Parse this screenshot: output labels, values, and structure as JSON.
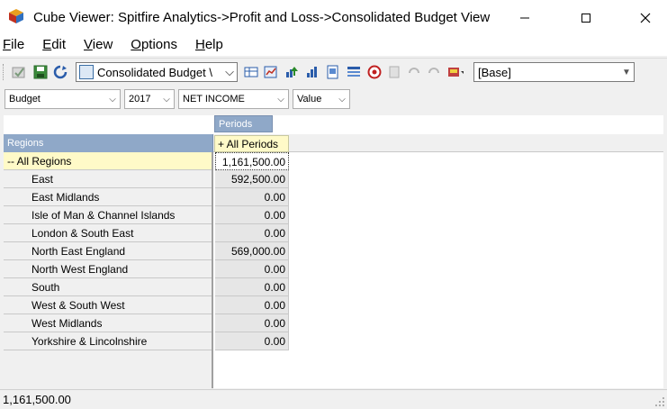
{
  "window": {
    "title": "Cube Viewer: Spitfire Analytics->Profit and Loss->Consolidated Budget View"
  },
  "menu": {
    "file": {
      "rest": "ile",
      "key": "F"
    },
    "edit": {
      "rest": "dit",
      "key": "E"
    },
    "view": {
      "rest": "iew",
      "key": "V"
    },
    "options": {
      "rest": "ptions",
      "key": "O"
    },
    "help": {
      "rest": "elp",
      "key": "H"
    }
  },
  "toolbar": {
    "view_select": "Consolidated Budget \\",
    "base_select": "[Base]"
  },
  "filters": {
    "scenario": "Budget",
    "year": "2017",
    "account": "NET INCOME",
    "measure": "Value"
  },
  "grid": {
    "column_dimension": "Periods",
    "row_dimension": "Regions",
    "column_header": "+ All Periods",
    "rows": [
      {
        "label": "-- All Regions",
        "value": "1,161,500.00"
      },
      {
        "label": "East",
        "value": "592,500.00"
      },
      {
        "label": "East Midlands",
        "value": "0.00"
      },
      {
        "label": "Isle of Man & Channel Islands",
        "value": "0.00"
      },
      {
        "label": "London & South East",
        "value": "0.00"
      },
      {
        "label": "North East England",
        "value": "569,000.00"
      },
      {
        "label": "North West England",
        "value": "0.00"
      },
      {
        "label": "South",
        "value": "0.00"
      },
      {
        "label": "West & South West",
        "value": "0.00"
      },
      {
        "label": "West Midlands",
        "value": "0.00"
      },
      {
        "label": "Yorkshire & Lincolnshire",
        "value": "0.00"
      }
    ]
  },
  "status": {
    "text": "1,161,500.00"
  }
}
